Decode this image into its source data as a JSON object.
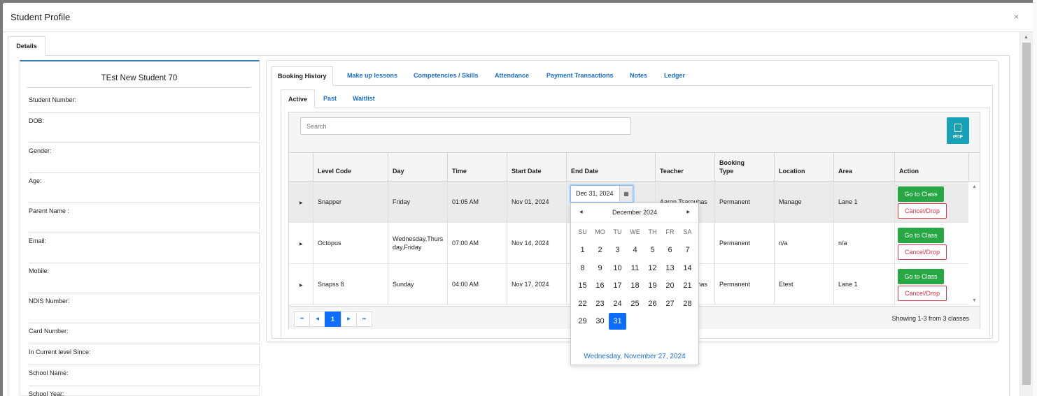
{
  "modal": {
    "title": "Student Profile",
    "close": "×"
  },
  "details_tab": "Details",
  "student": {
    "name": "TEst New Student 70",
    "fields": [
      "Student Number:",
      "DOB:",
      "Gender:",
      "Age:",
      "Parent Name :",
      "Email:",
      "Mobile:",
      "NDIS Number:",
      "Card Number:",
      "In Current level Since:",
      "School Name:",
      "School Year:"
    ]
  },
  "main_tabs": [
    "Booking History",
    "Make up lessons",
    "Competencies / Skills",
    "Attendance",
    "Payment Transactions",
    "Notes",
    "Ledger"
  ],
  "sub_tabs": [
    "Active",
    "Past",
    "Waitlist"
  ],
  "search": {
    "placeholder": "Search"
  },
  "pdf_label": "PDF",
  "columns": [
    "Level Code",
    "Day",
    "Time",
    "Start Date",
    "End Date",
    "Teacher",
    "Booking Type",
    "Location",
    "Area",
    "Action"
  ],
  "rows": [
    {
      "level": "Snapper",
      "day": "Friday",
      "time": "01:05 AM",
      "start": "Nov 01, 2024",
      "end": "",
      "teacher": "Aaron Tsarouhas",
      "type": "Permanent",
      "location": "Manage",
      "area": "Lane 1"
    },
    {
      "level": "Octopus",
      "day": "Wednesday,Thursday,Friday",
      "time": "07:00 AM",
      "start": "Nov 14, 2024",
      "end": "",
      "teacher": "",
      "type": "Permanent",
      "location": "n/a",
      "area": "n/a"
    },
    {
      "level": "Snapss 8",
      "day": "Sunday",
      "time": "04:00 AM",
      "start": "Nov 17, 2024",
      "end": "",
      "teacher": "Aaron Tsarouhas",
      "type": "Permanent",
      "location": "Etest",
      "area": "Lane 1"
    }
  ],
  "actions": {
    "go": "Go to Class",
    "drop": "Cancel/Drop"
  },
  "pager": {
    "first": "⏮",
    "prev": "◀",
    "page": "1",
    "next": "▶",
    "last": "⏭",
    "info": "Showing 1-3 from 3 classes"
  },
  "date_input": {
    "value": "Dec 31, 2024",
    "icon": "calendar-icon"
  },
  "calendar": {
    "title": "December 2024",
    "dow": [
      "SU",
      "MO",
      "TU",
      "WE",
      "TH",
      "FR",
      "SA"
    ],
    "weeks": [
      [
        "1",
        "2",
        "3",
        "4",
        "5",
        "6",
        "7"
      ],
      [
        "8",
        "9",
        "10",
        "11",
        "12",
        "13",
        "14"
      ],
      [
        "15",
        "16",
        "17",
        "18",
        "19",
        "20",
        "21"
      ],
      [
        "22",
        "23",
        "24",
        "25",
        "26",
        "27",
        "28"
      ],
      [
        "29",
        "30",
        "31"
      ]
    ],
    "selected": "31",
    "footer": "Wednesday, November 27, 2024"
  },
  "colors": {
    "accent": "#1a6fd1",
    "go": "#28a745",
    "drop": "#dc3545",
    "pdf": "#17a2b8",
    "selected": "#0d6efd"
  }
}
